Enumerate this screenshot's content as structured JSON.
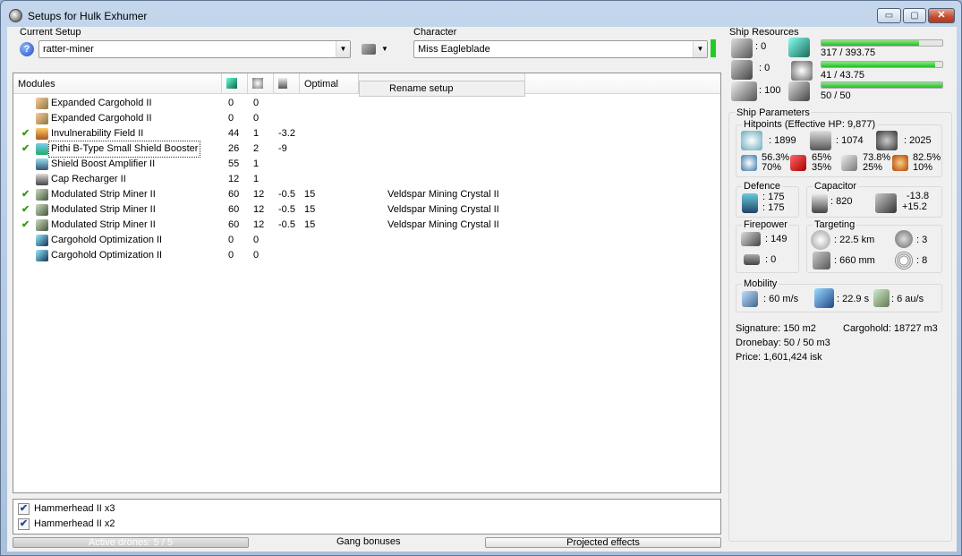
{
  "window": {
    "title": "Setups for Hulk Exhumer",
    "minimize": "▭",
    "maximize": "▢",
    "close": "✕"
  },
  "setup": {
    "label": "Current Setup",
    "value": "ratter-miner",
    "help": "?",
    "context_menu_item": "Rename setup"
  },
  "character": {
    "label": "Character",
    "value": "Miss Eagleblade",
    "status_color": "#22cc22"
  },
  "modules": {
    "columns": {
      "name": "Modules",
      "optimal": "Optimal"
    },
    "rows": [
      {
        "check": "",
        "name": "Expanded Cargohold II",
        "c1": "0",
        "c2": "0",
        "c3": "",
        "optimal": "",
        "charge": "",
        "icon": "cargohold-icon"
      },
      {
        "check": "",
        "name": "Expanded Cargohold II",
        "c1": "0",
        "c2": "0",
        "c3": "",
        "optimal": "",
        "charge": "",
        "icon": "cargohold-icon"
      },
      {
        "check": "✔",
        "name": "Invulnerability Field II",
        "c1": "44",
        "c2": "1",
        "c3": "-3.2",
        "optimal": "",
        "charge": "",
        "icon": "invulnerability-field-icon"
      },
      {
        "check": "✔",
        "name": "Pithi B-Type Small Shield Booster",
        "c1": "26",
        "c2": "2",
        "c3": "-9",
        "optimal": "",
        "charge": "",
        "icon": "shield-booster-icon"
      },
      {
        "check": "",
        "name": "Shield Boost Amplifier II",
        "c1": "55",
        "c2": "1",
        "c3": "",
        "optimal": "",
        "charge": "",
        "icon": "shield-amplifier-icon"
      },
      {
        "check": "",
        "name": "Cap Recharger II",
        "c1": "12",
        "c2": "1",
        "c3": "",
        "optimal": "",
        "charge": "",
        "icon": "cap-recharger-icon"
      },
      {
        "check": "✔",
        "name": "Modulated Strip Miner II",
        "c1": "60",
        "c2": "12",
        "c3": "-0.5",
        "optimal": "15",
        "charge": "Veldspar Mining Crystal II",
        "icon": "strip-miner-icon"
      },
      {
        "check": "✔",
        "name": "Modulated Strip Miner II",
        "c1": "60",
        "c2": "12",
        "c3": "-0.5",
        "optimal": "15",
        "charge": "Veldspar Mining Crystal II",
        "icon": "strip-miner-icon"
      },
      {
        "check": "✔",
        "name": "Modulated Strip Miner II",
        "c1": "60",
        "c2": "12",
        "c3": "-0.5",
        "optimal": "15",
        "charge": "Veldspar Mining Crystal II",
        "icon": "strip-miner-icon"
      },
      {
        "check": "",
        "name": "Cargohold Optimization II",
        "c1": "0",
        "c2": "0",
        "c3": "",
        "optimal": "",
        "charge": "",
        "icon": "cargohold-optimization-icon"
      },
      {
        "check": "",
        "name": "Cargohold Optimization II",
        "c1": "0",
        "c2": "0",
        "c3": "",
        "optimal": "",
        "charge": "",
        "icon": "cargohold-optimization-icon"
      }
    ]
  },
  "drones": {
    "items": [
      {
        "label": "Hammerhead II x3",
        "checked": "✔"
      },
      {
        "label": "Hammerhead II x2",
        "checked": "✔"
      }
    ],
    "active": "Active drones: 5 / 5",
    "gang": "Gang bonuses",
    "projected": "Projected effects"
  },
  "resources": {
    "title": "Ship Resources",
    "turrets": ": 0",
    "launchers": ": 0",
    "calibration": ": 100",
    "cpu": "317 / 393.75",
    "cpu_fraction": 0.81,
    "power": "41 / 43.75",
    "power_fraction": 0.94,
    "drone_bw": "50 / 50",
    "drone_bw_fraction": 1.0
  },
  "params": {
    "title": "Ship Parameters",
    "hitpoints": {
      "title": "Hitpoints (Effective HP: 9,877)",
      "shield": ": 1899",
      "armor": ": 1074",
      "structure": ": 2025",
      "em_shield": "56.3%",
      "em_armor": "70%",
      "th_shield": "65%",
      "th_armor": "35%",
      "ki_shield": "73.8%",
      "ki_armor": "25%",
      "ex_shield": "82.5%",
      "ex_armor": "10%"
    },
    "defence": {
      "title": "Defence",
      "v1": ": 175",
      "v2": ": 175"
    },
    "capacitor": {
      "title": "Capacitor",
      "cap": ": 820",
      "delta1": "-13.8",
      "delta2": "+15.2"
    },
    "firepower": {
      "title": "Firepower",
      "dps": ": 149",
      "volley": ": 0"
    },
    "targeting": {
      "title": "Targeting",
      "range": ": 22.5 km",
      "targets": ": 3",
      "resolution": ": 660 mm",
      "sensor": ": 8"
    },
    "mobility": {
      "title": "Mobility",
      "speed": ": 60 m/s",
      "align": ": 22.9 s",
      "warp": ": 6 au/s"
    },
    "signature": "Signature: 150 m2",
    "cargohold": "Cargohold: 18727 m3",
    "dronebay": "Dronebay: 50 / 50 m3",
    "price": "Price: 1,601,424 isk"
  }
}
